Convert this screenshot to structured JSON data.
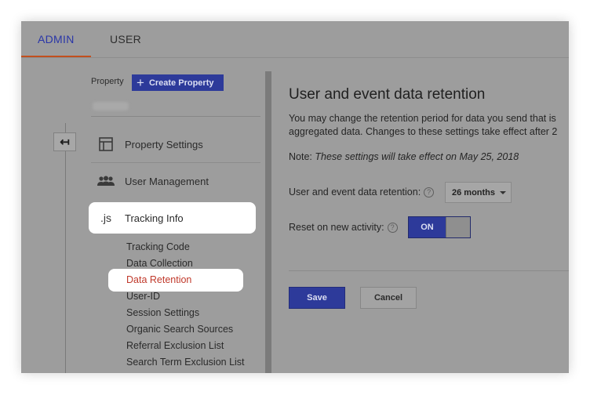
{
  "tabs": [
    {
      "label": "ADMIN"
    },
    {
      "label": "USER"
    }
  ],
  "back_button": {
    "icon": "back-arrow-icon",
    "glyph": "↤"
  },
  "property": {
    "label": "Property",
    "create_button": "Create Property",
    "create_icon": "+"
  },
  "menu": {
    "property_settings": {
      "label": "Property Settings",
      "icon": "layout-icon"
    },
    "user_management": {
      "label": "User Management",
      "icon": "people-icon"
    },
    "tracking_info": {
      "label": "Tracking Info",
      "icon": "js-icon",
      "icon_text": ".js"
    },
    "sub_items": [
      {
        "label": "Tracking Code"
      },
      {
        "label": "Data Collection"
      },
      {
        "label": "Data Retention",
        "active": true
      },
      {
        "label": "User-ID"
      },
      {
        "label": "Session Settings"
      },
      {
        "label": "Organic Search Sources"
      },
      {
        "label": "Referral Exclusion List"
      },
      {
        "label": "Search Term Exclusion List"
      }
    ]
  },
  "panel": {
    "title": "User and event data retention",
    "desc_line1": "You may change the retention period for data you send that is",
    "desc_line2": "aggregated data. Changes to these settings take effect after 2",
    "note_prefix": "Note: ",
    "note_text": "These settings will take effect on May 25, 2018",
    "retention_label": "User and event data retention:",
    "retention_value": "26 months",
    "reset_label": "Reset on new activity:",
    "reset_toggle": "ON",
    "help_glyph": "?",
    "save": "Save",
    "cancel": "Cancel"
  },
  "colors": {
    "accent": "#2d3a9a",
    "active_tab_underline": "#c2501e",
    "active_link": "#c0392b",
    "overlay": "#9d9d9d"
  }
}
